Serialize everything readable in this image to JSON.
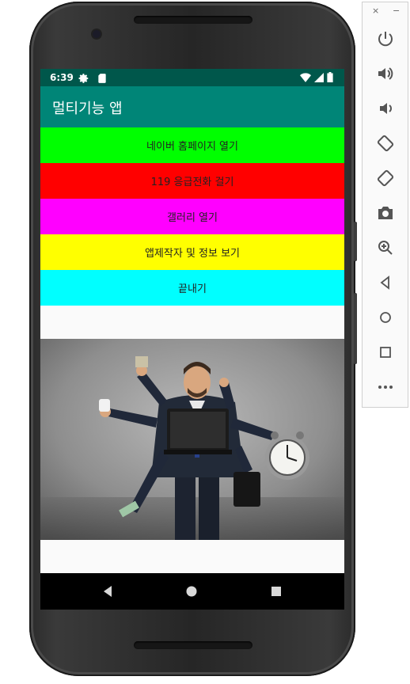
{
  "status_bar": {
    "time": "6:39",
    "icons_left": [
      "gear-icon",
      "sd-card-icon"
    ],
    "icons_right": [
      "wifi-icon",
      "signal-icon",
      "battery-icon"
    ]
  },
  "app_bar": {
    "title": "멀티기능 앱"
  },
  "buttons": [
    {
      "label": "네이버 홈페이지 열기",
      "color": "#00ff00"
    },
    {
      "label": "119 응급전화 걸기",
      "color": "#ff0000"
    },
    {
      "label": "갤러리 열기",
      "color": "#ff00ff"
    },
    {
      "label": "앱제작자 및 정보 보기",
      "color": "#ffff00"
    },
    {
      "label": "끝내기",
      "color": "#00ffff"
    }
  ],
  "image": {
    "subject": "businessman-multitasking-photo"
  },
  "nav_bar": {
    "items": [
      "back-icon",
      "home-icon",
      "recents-icon"
    ]
  },
  "emulator_toolbar": {
    "close": "×",
    "minimize": "−",
    "items": [
      "power-icon",
      "volume-up-icon",
      "volume-down-icon",
      "rotate-left-icon",
      "rotate-right-icon",
      "camera-icon",
      "zoom-icon",
      "back-icon",
      "home-icon",
      "overview-icon",
      "more-icon"
    ]
  },
  "colors": {
    "status_bar": "#00574b",
    "app_bar": "#008577",
    "nav_bar": "#000000"
  }
}
